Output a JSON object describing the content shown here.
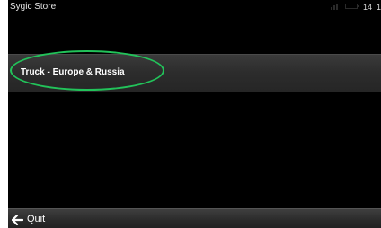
{
  "status_bar": {
    "app_title": "Sygic Store",
    "clock_hour": "14",
    "clock_extra": "1",
    "icons": [
      "signal-icon",
      "battery-icon"
    ]
  },
  "store": {
    "items": [
      {
        "label": "Truck - Europe & Russia",
        "highlighted": true
      }
    ]
  },
  "bottom_bar": {
    "back_icon": "back-arrow-icon",
    "quit_label": "Quit"
  },
  "colors": {
    "background": "#000000",
    "highlight": "#22c35a",
    "text": "#ffffff"
  }
}
